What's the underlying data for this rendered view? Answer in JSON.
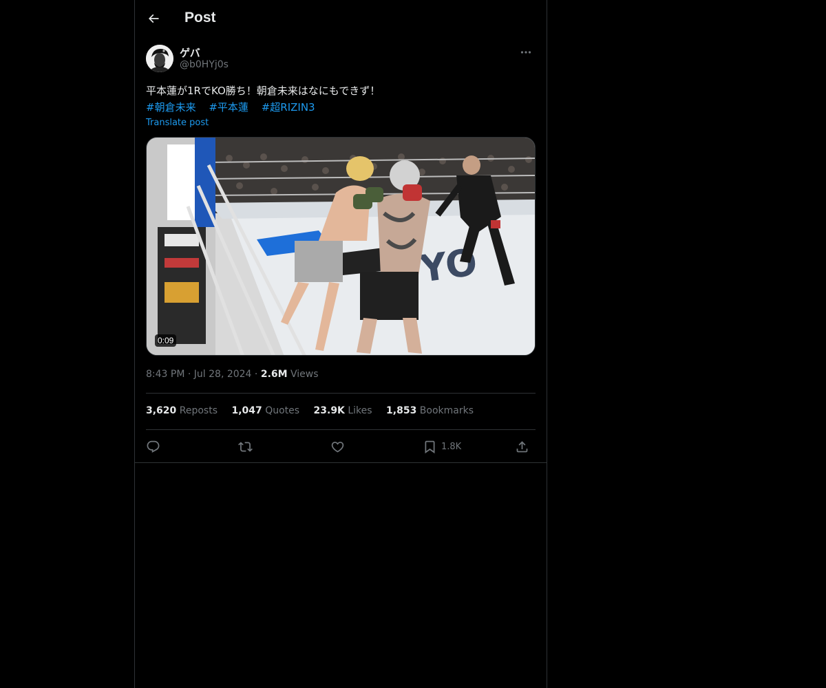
{
  "header": {
    "title": "Post",
    "back_icon": "arrow-left-icon"
  },
  "author": {
    "display_name": "ゲバ",
    "handle": "@b0HYj0s"
  },
  "post": {
    "text": "平本蓮が1RでKO勝ち！朝倉未来はなにもできず！",
    "hashtags": [
      "#朝倉未来",
      "#平本蓮",
      "#超RIZIN3"
    ],
    "translate_label": "Translate post"
  },
  "media": {
    "duration": "0:09"
  },
  "meta": {
    "time": "8:43 PM",
    "date": "Jul 28, 2024",
    "views_count": "2.6M",
    "views_label": "Views"
  },
  "stats": {
    "reposts_count": "3,620",
    "reposts_label": "Reposts",
    "quotes_count": "1,047",
    "quotes_label": "Quotes",
    "likes_count": "23.9K",
    "likes_label": "Likes",
    "bookmarks_count": "1,853",
    "bookmarks_label": "Bookmarks"
  },
  "actions": {
    "bookmark_count": "1.8K"
  },
  "colors": {
    "background": "#000000",
    "text": "#e7e9ea",
    "secondary": "#71767b",
    "accent": "#1d9bf0",
    "border": "#2f3336"
  }
}
